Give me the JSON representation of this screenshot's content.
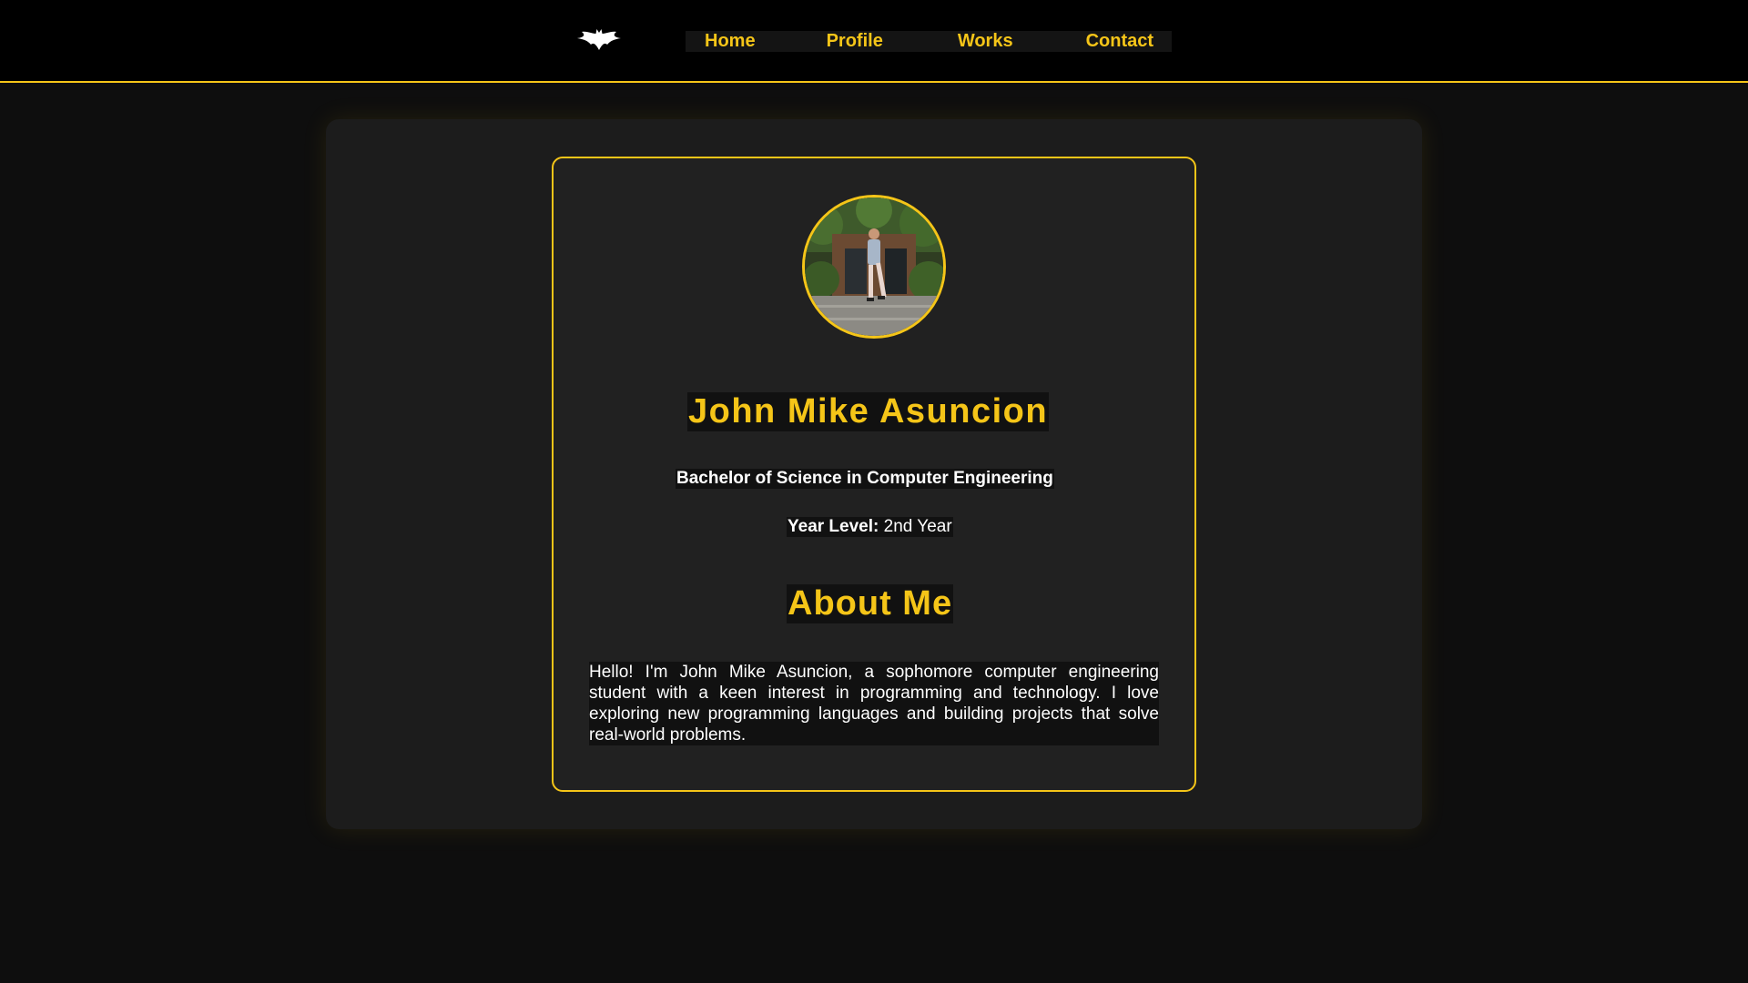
{
  "header": {
    "logo_icon": "bat-logo-icon",
    "nav": {
      "home": "Home",
      "profile": "Profile",
      "works": "Works",
      "contact": "Contact"
    }
  },
  "profile": {
    "avatar_icon": "profile-photo",
    "name": "John Mike Asuncion",
    "degree": "Bachelor of Science in Computer Engineering",
    "year_label": "Year Level:",
    "year_value": " 2nd Year"
  },
  "about": {
    "title": "About Me",
    "text": "Hello! I'm John Mike Asuncion, a sophomore computer engineering student with a keen interest in programming and technology. I love exploring new programming languages and building projects that solve real-world problems."
  },
  "colors": {
    "accent": "#f5c518",
    "background": "#0e0e0e",
    "panel": "#1c1c1c",
    "card": "#212121"
  }
}
